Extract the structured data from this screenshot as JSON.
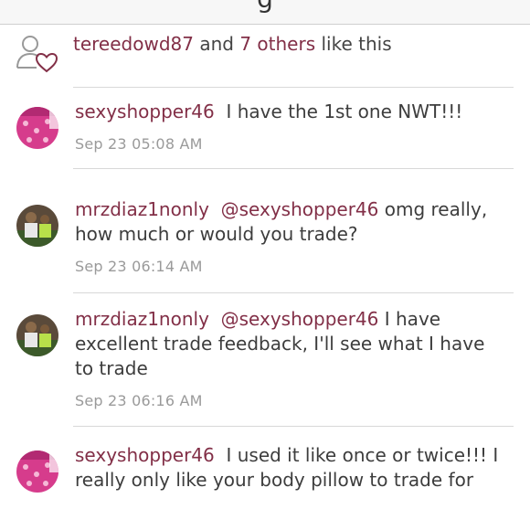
{
  "header": {
    "title": "g"
  },
  "likes": {
    "user": "tereedowd87",
    "connector": " and ",
    "others": "7 others",
    "suffix": " like this"
  },
  "comments": [
    {
      "user": "sexyshopper46",
      "mention": "",
      "text": "I have the 1st one NWT!!!",
      "time": "Sep 23 05:08 AM",
      "avatar": "pink-item-avatar"
    },
    {
      "user": "mrzdiaz1nonly",
      "mention": "@sexyshopper46",
      "text": "omg really, how much or would you trade?",
      "time": "Sep 23 06:14 AM",
      "avatar": "kids-photo-avatar"
    },
    {
      "user": "mrzdiaz1nonly",
      "mention": "@sexyshopper46",
      "text": "I have excellent trade feedback, I'll see what I have to trade",
      "time": "Sep 23 06:16 AM",
      "avatar": "kids-photo-avatar"
    },
    {
      "user": "sexyshopper46",
      "mention": "",
      "text": "I used it like once or twice!!! I really only like your body pillow to trade for",
      "time": "",
      "avatar": "pink-item-avatar"
    }
  ],
  "colors": {
    "accent": "#822f47",
    "text": "#3d3d3d",
    "muted": "#9a9a9a"
  }
}
